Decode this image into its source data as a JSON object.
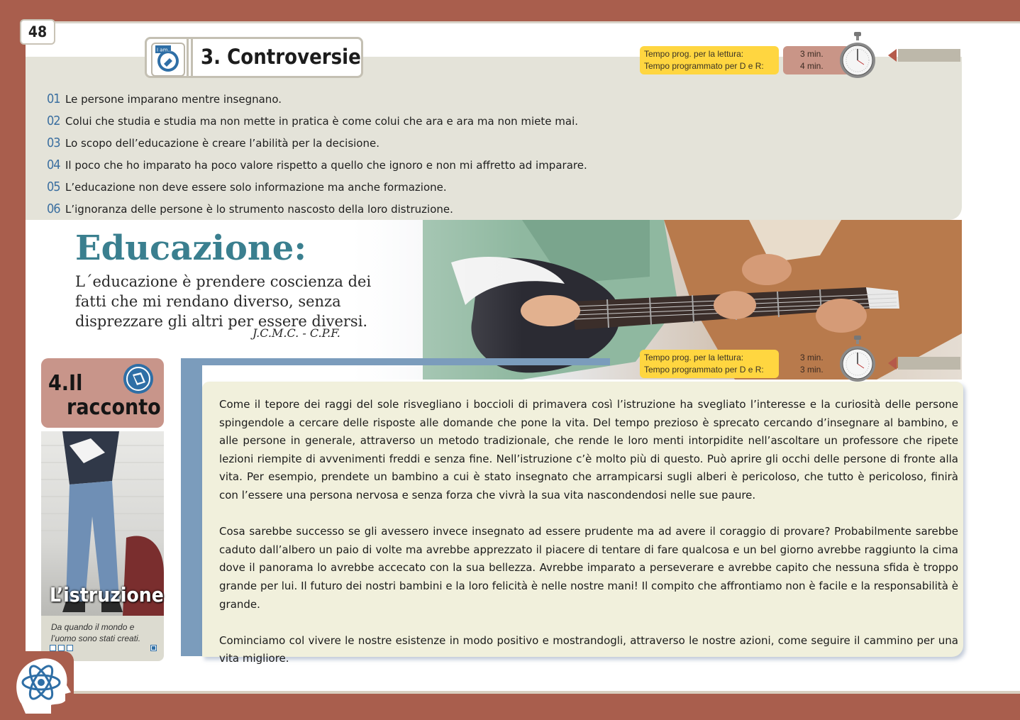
{
  "page_number": "48",
  "section3": {
    "icon_label": "I am...",
    "title": "3. Controversie",
    "timer": {
      "label_reading": "Tempo prog. per la lettura:",
      "label_dr": "Tempo programmato per D e R:",
      "min_reading": "3 min.",
      "min_dr": "4 min."
    },
    "quotes": [
      {
        "num": "01",
        "text": "Le persone imparano mentre insegnano."
      },
      {
        "num": "02",
        "text": "Colui che studia e studia ma non mette in pratica è come colui che ara e ara ma non miete mai."
      },
      {
        "num": "03",
        "text": "Lo scopo dell’educazione è creare l’abilità per la decisione."
      },
      {
        "num": "04",
        "text": "Il poco che ho imparato ha poco valore rispetto a quello che ignoro e non mi affretto ad imparare."
      },
      {
        "num": "05",
        "text": "L’educazione non deve essere solo informazione ma anche formazione."
      },
      {
        "num": "06",
        "text": "L’ignoranza delle persone è lo strumento nascosto della loro distruzione."
      }
    ]
  },
  "education": {
    "title": "Educazione:",
    "body": "L´educazione è prendere coscienza dei fatti che mi rendano diverso, senza disprezzare gli altri per essere diversi.",
    "author": "J.C.M.C. - C.P.F."
  },
  "section4": {
    "title_line1": "4.Il",
    "title_line2": "racconto",
    "timer": {
      "label_reading": "Tempo prog. per la lettura:",
      "label_dr": "Tempo programmato per D e R:",
      "min_reading": "3 min.",
      "min_dr": "3 min."
    },
    "photo_caption": "L’istruzione",
    "photo_subtitle": "Da quando il mondo e l’uomo sono stati creati.",
    "paragraphs": [
      "Come il tepore dei raggi del sole risvegliano i boccioli di primavera così l’istruzione ha svegliato l’interesse e la curiosità delle persone spingendole a cercare delle risposte alle domande che pone la vita. Del tempo prezioso è sprecato cercando d’insegnare al bambino, e alle persone in generale, attraverso un metodo tradizionale, che rende le loro menti intorpidite nell’ascoltare un professore che ripete lezioni riempite di avvenimenti freddi e senza fine. Nell’istruzione c’è molto più di questo. Può aprire gli occhi delle persone di fronte alla vita. Per esempio, prendete un bambino a cui è stato insegnato che arrampicarsi sugli alberi è pericoloso, che tutto è pericoloso, finirà con l’essere una persona nervosa e senza forza che vivrà la sua vita nascondendosi nelle sue paure.",
      "Cosa sarebbe successo se gli avessero invece insegnato ad essere prudente ma ad avere il coraggio di provare? Probabilmente sarebbe caduto dall’albero un paio di volte ma avrebbe apprezzato il piacere di tentare di fare qualcosa e un bel giorno avrebbe raggiunto la cima dove il panorama lo avrebbe accecato con la sua bellezza. Avrebbe imparato a perseverare e avrebbe capito che nessuna sfida è troppo grande per lui. Il futuro dei nostri bambini e la loro felicità è nelle nostre mani! Il compito che affrontiamo non è facile e la responsabilità è grande.",
      "Cominciamo col vivere le nostre esistenze in modo positivo e mostrandogli, attraverso le nostre azioni, come seguire il cammino per una vita migliore."
    ]
  },
  "colors": {
    "frame": "#a95e4d",
    "accent_blue": "#3b6fa0",
    "timer_yellow": "#ffd640",
    "panel_gray": "#e4e3d9",
    "text_box": "#f1f0dc"
  },
  "icons": [
    "stopwatch-icon",
    "atom-head-logo-icon",
    "i-am-icon",
    "book-icon"
  ]
}
